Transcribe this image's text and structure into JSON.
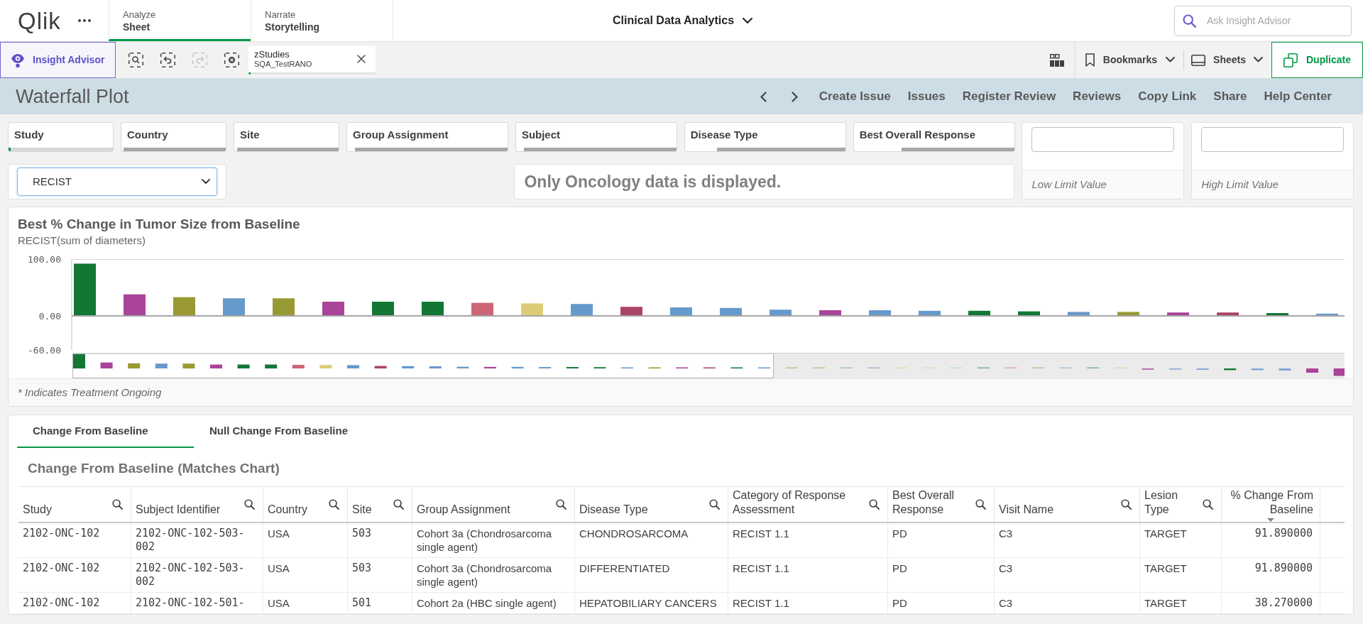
{
  "app_bar": {
    "logo": "Qlik",
    "nav_tabs": [
      {
        "label": "Analyze",
        "value": "Sheet",
        "selected": true
      },
      {
        "label": "Narrate",
        "value": "Storytelling",
        "selected": false
      }
    ],
    "app_title": "Clinical Data Analytics",
    "search": {
      "placeholder": "Ask Insight Advisor"
    }
  },
  "toolbar": {
    "insight_button": "Insight Advisor",
    "tools": [
      {
        "kind": "search",
        "disabled": false
      },
      {
        "kind": "back",
        "disabled": false
      },
      {
        "kind": "forward",
        "disabled": true
      },
      {
        "kind": "clear",
        "disabled": false
      }
    ],
    "selection": {
      "field": "zStudies",
      "value": "SQA_TestRANO"
    },
    "bookmarks_button": "Bookmarks",
    "sheets_button": "Sheets",
    "duplicate_button": "Duplicate"
  },
  "sheet_header": {
    "title": "Waterfall Plot",
    "links": [
      "Create Issue",
      "Issues",
      "Register Review",
      "Reviews",
      "Copy Link",
      "Share",
      "Help Center"
    ]
  },
  "filters": [
    {
      "label": "Study",
      "selected": true,
      "level": 0.02
    },
    {
      "label": "Country",
      "selected": false,
      "level": 0.02
    },
    {
      "label": "Site",
      "selected": false,
      "level": 0.03
    },
    {
      "label": "Group Assignment",
      "selected": false,
      "level": 0.05
    },
    {
      "label": "Subject",
      "selected": false,
      "level": 0.05
    },
    {
      "label": "Disease Type",
      "selected": false,
      "level": 0.2
    },
    {
      "label": "Best Overall Response",
      "selected": false,
      "level": 0.3
    }
  ],
  "measure_dropdown": {
    "value": "RECIST"
  },
  "notice": "Only Oncology data is displayed.",
  "limit_inputs": [
    {
      "label": "Low Limit Value"
    },
    {
      "label": "High Limit Value"
    }
  ],
  "chart": {
    "title": "Best % Change in Tumor Size from Baseline",
    "subtitle": "RECIST(sum of diameters)",
    "footnote": "* Indicates Treatment Ongoing",
    "chart_data": {
      "type": "bar",
      "ylim": [
        -60,
        100
      ],
      "yticks": [
        {
          "value": 100,
          "label": "100.00"
        },
        {
          "value": 0,
          "label": "0.00"
        },
        {
          "value": -60,
          "label": "-60.00"
        }
      ],
      "stacked": true,
      "series": [
        {
          "color": "#117733",
          "values": [
            92,
            null,
            null,
            null,
            null,
            null,
            25,
            25,
            null,
            null,
            null,
            null,
            null,
            null,
            null,
            null,
            null,
            null,
            9,
            8,
            null,
            null,
            null,
            null,
            5,
            null
          ]
        },
        {
          "color": "#aa4499",
          "values": [
            null,
            38,
            null,
            null,
            null,
            25,
            null,
            null,
            null,
            null,
            null,
            null,
            null,
            null,
            null,
            10,
            null,
            null,
            null,
            null,
            null,
            null,
            6,
            null,
            null,
            null
          ]
        },
        {
          "color": "#999933",
          "values": [
            null,
            null,
            33,
            null,
            31,
            null,
            null,
            null,
            null,
            null,
            null,
            null,
            null,
            null,
            null,
            null,
            null,
            null,
            null,
            null,
            null,
            7,
            null,
            null,
            null,
            null
          ]
        },
        {
          "color": "#6699cc",
          "values": [
            null,
            null,
            null,
            31,
            null,
            null,
            null,
            null,
            null,
            null,
            21,
            null,
            15,
            14,
            11,
            null,
            10,
            9,
            null,
            null,
            7,
            null,
            null,
            null,
            null,
            4
          ]
        },
        {
          "color": "#cc6677",
          "values": [
            null,
            null,
            null,
            null,
            null,
            null,
            null,
            null,
            23,
            null,
            null,
            null,
            null,
            null,
            null,
            null,
            null,
            null,
            null,
            null,
            null,
            null,
            null,
            null,
            null,
            null
          ]
        },
        {
          "color": "#ddcc77",
          "values": [
            null,
            null,
            null,
            null,
            null,
            null,
            null,
            null,
            null,
            22,
            null,
            null,
            null,
            null,
            null,
            null,
            null,
            null,
            null,
            null,
            null,
            null,
            null,
            null,
            null,
            null
          ]
        },
        {
          "color": "#aa4466",
          "values": [
            null,
            null,
            null,
            null,
            null,
            null,
            null,
            null,
            null,
            null,
            null,
            16,
            null,
            null,
            null,
            null,
            null,
            null,
            null,
            null,
            null,
            null,
            null,
            6,
            null,
            null
          ]
        }
      ]
    }
  },
  "tabs": [
    {
      "label": "Change From Baseline",
      "selected": true
    },
    {
      "label": "Null Change From Baseline",
      "selected": false
    }
  ],
  "table": {
    "title": "Change From Baseline (Matches Chart)",
    "columns": [
      {
        "label": "Study",
        "kind": "code",
        "sorted": false
      },
      {
        "label": "Subject Identifier",
        "kind": "code",
        "sorted": false
      },
      {
        "label": "Country",
        "kind": "text",
        "sorted": false
      },
      {
        "label": "Site",
        "kind": "code",
        "sorted": false
      },
      {
        "label": "Group Assignment",
        "kind": "text",
        "sorted": false
      },
      {
        "label": "Disease Type",
        "kind": "text",
        "sorted": false
      },
      {
        "label": "Category of Response Assessment",
        "kind": "text",
        "sorted": false
      },
      {
        "label": "Best Overall Response",
        "kind": "text",
        "sorted": false
      },
      {
        "label": "Visit Name",
        "kind": "text",
        "sorted": false
      },
      {
        "label": "Lesion Type",
        "kind": "text",
        "sorted": false
      },
      {
        "label": "% Change From Baseline",
        "kind": "number",
        "sorted": true
      }
    ],
    "rows": [
      [
        "2102-ONC-102",
        "2102-ONC-102-503-002",
        "USA",
        "503",
        "Cohort 3a (Chondrosarcoma single agent)",
        "CHONDROSARCOMA",
        "RECIST 1.1",
        "PD",
        "C3",
        "TARGET",
        "91.890000"
      ],
      [
        "2102-ONC-102",
        "2102-ONC-102-503-002",
        "USA",
        "503",
        "Cohort 3a (Chondrosarcoma single agent)",
        "DIFFERENTIATED",
        "RECIST 1.1",
        "PD",
        "C3",
        "TARGET",
        "91.890000"
      ],
      [
        "2102-ONC-102",
        "2102-ONC-102-501-",
        "USA",
        "501",
        "Cohort 2a (HBC single agent)",
        "HEPATOBILIARY CANCERS",
        "RECIST 1.1",
        "PD",
        "C3",
        "TARGET",
        "38.270000"
      ]
    ]
  }
}
